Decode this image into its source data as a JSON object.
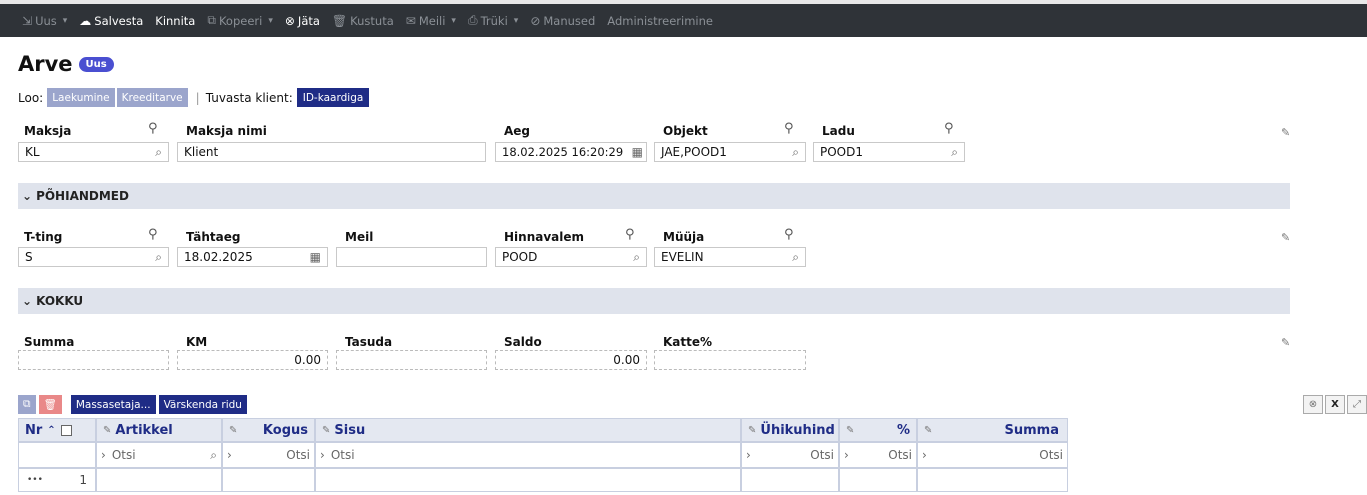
{
  "toolbar": {
    "new": "Uus",
    "save": "Salvesta",
    "confirm": "Kinnita",
    "copy": "Kopeeri",
    "discard": "Jäta",
    "delete": "Kustuta",
    "mail": "Meili",
    "print": "Trüki",
    "attachments": "Manused",
    "admin": "Administreerimine"
  },
  "page": {
    "title": "Arve",
    "badge": "Uus"
  },
  "create": {
    "label": "Loo:",
    "receipt": "Laekumine",
    "credit": "Kreeditarve",
    "identify_label": "Tuvasta klient:",
    "id_card": "ID-kaardiga"
  },
  "header_fields": {
    "payer_label": "Maksja",
    "payer_value": "KL",
    "payer_name_label": "Maksja nimi",
    "payer_name_value": "Klient",
    "time_label": "Aeg",
    "time_value": "18.02.2025 16:20:29",
    "object_label": "Objekt",
    "object_value": "JAE,POOD1",
    "warehouse_label": "Ladu",
    "warehouse_value": "POOD1"
  },
  "sections": {
    "main": "PÕHIANDMED",
    "totals": "KOKKU"
  },
  "main_fields": {
    "terms_label": "T-ting",
    "terms_value": "S",
    "due_label": "Tähtaeg",
    "due_value": "18.02.2025",
    "email_label": "Meil",
    "email_value": "",
    "pricing_label": "Hinnavalem",
    "pricing_value": "POOD",
    "seller_label": "Müüja",
    "seller_value": "EVELIN"
  },
  "totals": {
    "sum_label": "Summa",
    "sum_value": "",
    "vat_label": "KM",
    "vat_value": "0.00",
    "paid_label": "Tasuda",
    "paid_value": "",
    "balance_label": "Saldo",
    "balance_value": "0.00",
    "margin_label": "Katte%",
    "margin_value": ""
  },
  "grid_toolbar": {
    "mass_set": "Massasetaja...",
    "refresh_row": "Värskenda ridu"
  },
  "grid": {
    "columns": {
      "nr": "Nr",
      "article": "Artikkel",
      "qty": "Kogus",
      "content": "Sisu",
      "unit_price": "Ühikuhind",
      "pct": "%",
      "sum": "Summa"
    },
    "search_placeholder": "Otsi",
    "row_more": "•••",
    "row_number": "1"
  },
  "icons": [
    "new-icon",
    "save-icon",
    "copy-icon",
    "discard-icon",
    "delete-icon",
    "mail-icon",
    "print-icon",
    "attachment-icon",
    "link-icon",
    "search-icon",
    "calendar-icon",
    "wrench-icon",
    "chevron-down-icon",
    "sort-icon"
  ],
  "colors": {
    "toolbar_bg": "#2f3338",
    "accent": "#1f2c86",
    "badge": "#4a4fd1",
    "section_bg": "#dfe3ec",
    "light_btn": "#9ba5cc",
    "danger_btn": "#e98888"
  }
}
